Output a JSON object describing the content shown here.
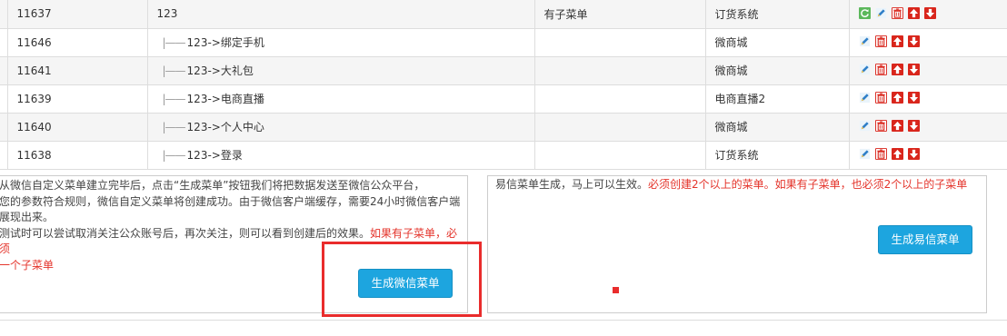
{
  "rows": [
    {
      "id": "11637",
      "name": "123",
      "child": false,
      "type": "有子菜单",
      "system": "订货系统",
      "refresh": true
    },
    {
      "id": "11646",
      "name": "123->绑定手机",
      "child": true,
      "type": "",
      "system": "微商城",
      "refresh": false
    },
    {
      "id": "11641",
      "name": "123->大礼包",
      "child": true,
      "type": "",
      "system": "微商城",
      "refresh": false
    },
    {
      "id": "11639",
      "name": "123->电商直播",
      "child": true,
      "type": "",
      "system": "电商直播2",
      "refresh": false
    },
    {
      "id": "11640",
      "name": "123->个人中心",
      "child": true,
      "type": "",
      "system": "微商城",
      "refresh": false
    },
    {
      "id": "11638",
      "name": "123->登录",
      "child": true,
      "type": "",
      "system": "订货系统",
      "refresh": false
    }
  ],
  "tree_prefix": "|——",
  "wechat_panel": {
    "line1": "从微信自定义菜单建立完毕后，点击“生成菜单”按钮我们将把数据发送至微信公众平台，",
    "line2": "您的参数符合规则，微信自定义菜单将创建成功。由于微信客户端缓存，需要24小时微信客户端",
    "line3": "展现出来。",
    "line4": "测试时可以尝试取消关注公众账号后，再次关注，则可以看到创建后的效果。",
    "line4_red": "如果有子菜单，必须",
    "line5_red": "一个子菜单",
    "button": "生成微信菜单"
  },
  "yixin_panel": {
    "text": "易信菜单生成，马上可以生效。",
    "text_red": "必须创建2个以上的菜单。如果有子菜单，也必须2个以上的子菜单",
    "button": "生成易信菜单"
  },
  "colors": {
    "accent": "#1da5df",
    "warning": "#e4332a",
    "highlight": "#e92c2c"
  }
}
